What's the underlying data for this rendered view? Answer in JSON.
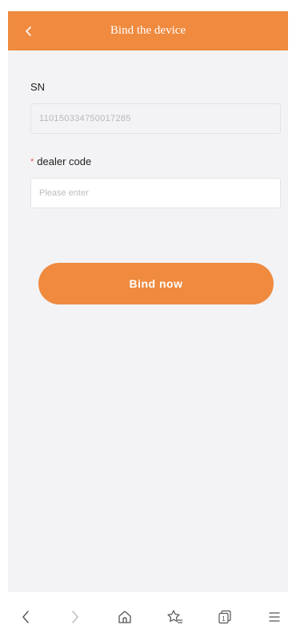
{
  "header": {
    "title": "Bind the device",
    "back_icon": "chevron-left-icon"
  },
  "form": {
    "sn_label": "SN",
    "sn_value": "110150334750017285",
    "dealer_required_mark": "*",
    "dealer_label": "dealer code",
    "dealer_value": "",
    "dealer_placeholder": "Please enter"
  },
  "actions": {
    "bind_label": "Bind now"
  },
  "browser_bar": {
    "icons": [
      "back-arrow-icon",
      "forward-arrow-icon",
      "home-icon",
      "favorites-icon",
      "tabs-icon",
      "menu-icon"
    ],
    "tab_count": "1"
  },
  "colors": {
    "accent": "#ef8a3f",
    "background": "#f3f3f5",
    "required": "#e45a4a"
  }
}
